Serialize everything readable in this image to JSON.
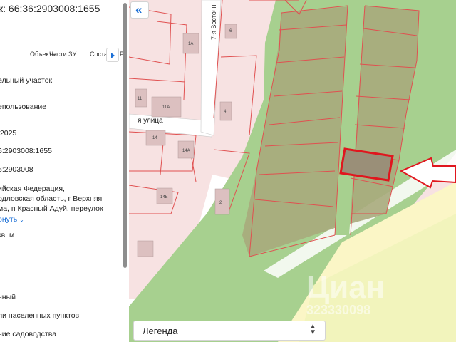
{
  "panel": {
    "title": "к: 66:36:2903008:1655",
    "tabs": [
      {
        "label": "Объекты"
      },
      {
        "label": "Части ЗУ"
      },
      {
        "label": "Состав"
      },
      {
        "label": "Р"
      }
    ],
    "fields": [
      {
        "text": "ельный участок"
      },
      {
        "text": "епользование"
      },
      {
        "text": ".2025"
      },
      {
        "text": "6:2903008:1655"
      },
      {
        "text": "6:2903008"
      },
      {
        "text": "ийская Федерация,"
      },
      {
        "text": "рдловская область, г Верхняя"
      },
      {
        "text": "ма, п Красный Адуй, переулок"
      },
      {
        "text": "рнуть"
      },
      {
        "text": "кв. м"
      },
      {
        "text": "нный"
      },
      {
        "text": "ли населенных пунктов"
      },
      {
        "text": "ние садоводства"
      }
    ]
  },
  "map": {
    "street_label": "я улица",
    "street_vertical": "7-я Восточн",
    "building_labels": [
      "1А",
      "11",
      "11А",
      "6",
      "4",
      "14",
      "14А",
      "14Б",
      "2"
    ],
    "watermark": "Циан",
    "watermark_id": "323330098",
    "legend_label": "Легенда",
    "collapse_symbol": "«"
  },
  "colors": {
    "accent": "#1b6fd6",
    "green_zone": "#a7d08f",
    "plot_fill": "#a9aa7c",
    "highlight_border": "#e0161e",
    "residential": "#f7e2e2",
    "yellow_zone": "#fbf6c6",
    "plot_border": "#e05050"
  }
}
